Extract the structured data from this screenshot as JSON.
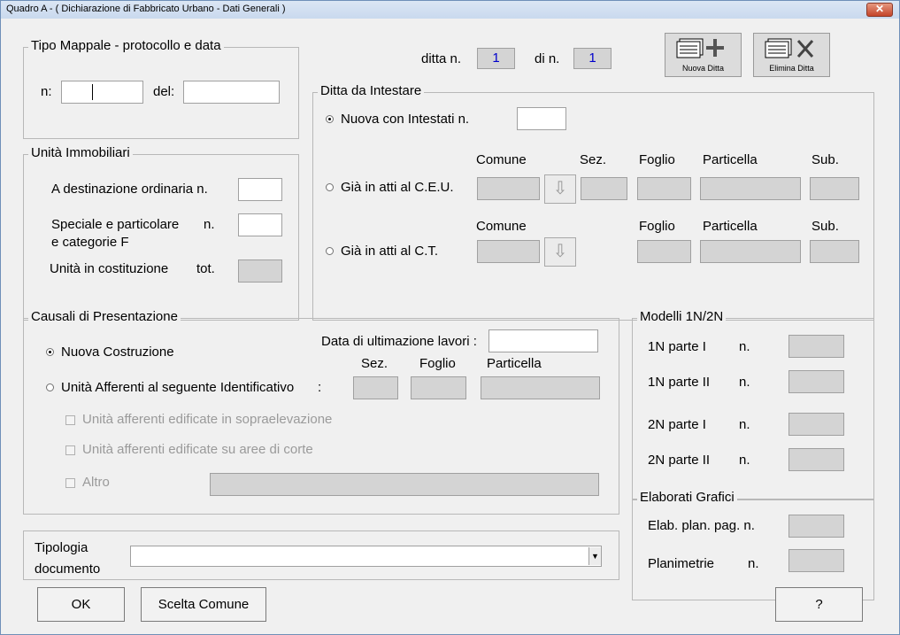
{
  "window": {
    "title": "Quadro A - ( Dichiarazione di Fabbricato Urbano - Dati Generali )",
    "close_icon": "close-x-icon"
  },
  "tipo_mappale": {
    "legend": "Tipo Mappale - protocollo e data",
    "n_label": "n:",
    "n_value": "",
    "del_label": "del:",
    "del_value": ""
  },
  "ditta": {
    "ditta_label": "ditta n.",
    "ditta_value": "1",
    "di_label": "di n.",
    "di_value": "1",
    "nuova_ditta_label": "Nuova Ditta",
    "elimina_ditta_label": "Elimina Ditta"
  },
  "unita_immobiliari": {
    "legend": "Unità Immobiliari",
    "ordinaria_label": "A destinazione ordinaria  n.",
    "ordinaria_value": "",
    "speciale_label_1": "Speciale e particolare",
    "speciale_label_2": "e categorie F",
    "speciale_n": "n.",
    "speciale_value": "",
    "costituzione_label": "Unità in costituzione",
    "costituzione_tot": "tot.",
    "costituzione_value": ""
  },
  "ditta_intestare": {
    "legend": "Ditta da Intestare",
    "nuova_label": "Nuova con Intestati  n.",
    "nuova_selected": true,
    "nuova_value": "",
    "ceu": {
      "radio_label": "Già in atti al C.E.U.",
      "hdr_comune": "Comune",
      "hdr_sez": "Sez.",
      "hdr_foglio": "Foglio",
      "hdr_particella": "Particella",
      "hdr_sub": "Sub."
    },
    "ct": {
      "radio_label": "Già in atti al C.T.",
      "hdr_comune": "Comune",
      "hdr_foglio": "Foglio",
      "hdr_particella": "Particella",
      "hdr_sub": "Sub."
    },
    "arrow_icon": "arrow-down-icon"
  },
  "causali": {
    "legend": "Causali di Presentazione",
    "nuova_costruzione_label": "Nuova Costruzione",
    "nuova_costruzione_selected": true,
    "data_ultimazione_label": "Data di ultimazione lavori :",
    "data_ultimazione_value": "",
    "afferenti_label": "Unità Afferenti al seguente Identificativo",
    "afferenti_colon": ":",
    "hdr_sez": "Sez.",
    "hdr_foglio": "Foglio",
    "hdr_particella": "Particella",
    "check_sopraelevazione": "Unità afferenti edificate in sopraelevazione",
    "check_corte": "Unità afferenti edificate su aree di corte",
    "check_altro": "Altro"
  },
  "modelli": {
    "legend": "Modelli 1N/2N",
    "rows": [
      {
        "label": "1N parte I",
        "n": "n."
      },
      {
        "label": "1N parte II",
        "n": "n."
      },
      {
        "label": "2N parte I",
        "n": "n."
      },
      {
        "label": "2N parte II",
        "n": "n."
      }
    ]
  },
  "elaborati": {
    "legend": "Elaborati Grafici",
    "elab_label": "Elab. plan. pag. n.",
    "planimetrie_label": "Planimetrie",
    "planimetrie_n": "n."
  },
  "tipologia": {
    "label_1": "Tipologia",
    "label_2": "documento",
    "selected": "",
    "dropdown_icon": "dropdown-arrow-icon"
  },
  "buttons": {
    "ok": "OK",
    "scelta_comune": "Scelta Comune",
    "help": "?"
  }
}
